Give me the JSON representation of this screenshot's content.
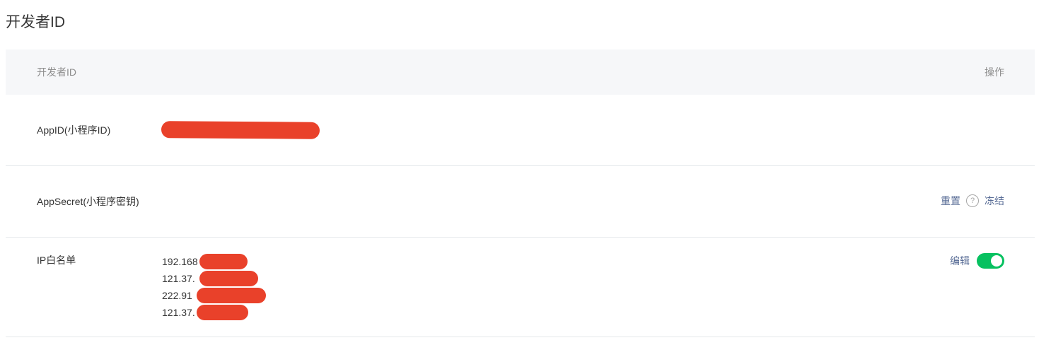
{
  "page": {
    "title": "开发者ID"
  },
  "table": {
    "header": {
      "name_col": "开发者ID",
      "action_col": "操作"
    },
    "rows": {
      "appid": {
        "label": "AppID(小程序ID)",
        "value_redacted": true
      },
      "appsecret": {
        "label": "AppSecret(小程序密钥)",
        "reset_label": "重置",
        "help_icon": "question-circle-icon",
        "freeze_label": "冻结"
      },
      "ip_whitelist": {
        "label": "IP白名单",
        "ips": [
          "192.168",
          "121.37.",
          "222.91",
          "121.37."
        ],
        "edit_label": "编辑",
        "enabled": true
      }
    }
  },
  "colors": {
    "link": "#576b95",
    "toggle_on": "#07c160",
    "redaction": "#e9412a",
    "header_bg": "#f6f7f9"
  }
}
